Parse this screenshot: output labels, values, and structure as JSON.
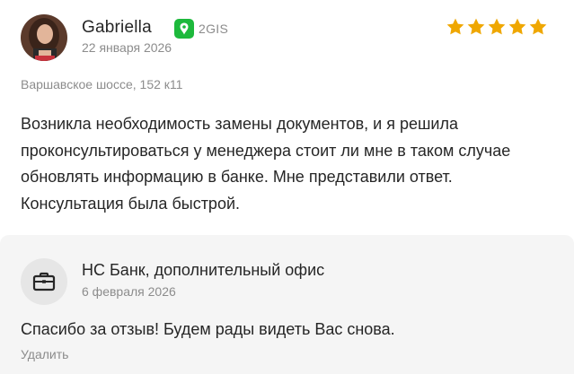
{
  "review": {
    "author": {
      "name": "Gabriella",
      "avatar": "avatar-photo"
    },
    "source": {
      "label": "2GIS",
      "icon": "2gis-logo-icon",
      "color": "#1db93c"
    },
    "date": "22 января 2026",
    "rating": 5,
    "rating_max": 5,
    "star_color": "#efa701",
    "address": "Варшавское шоссе, 152 к11",
    "text": "Возникла необходимость замены документов, и я решила проконсультироваться у менеджера стоит ли мне в таком случае обновлять информацию в банке. Мне представили ответ. Консультация была быстрой."
  },
  "reply": {
    "org_name": "НС Банк, дополнительный офис",
    "org_icon": "briefcase-icon",
    "date": "6 февраля 2026",
    "text": "Спасибо за отзыв! Будем рады видеть Вас снова.",
    "delete_label": "Удалить"
  }
}
